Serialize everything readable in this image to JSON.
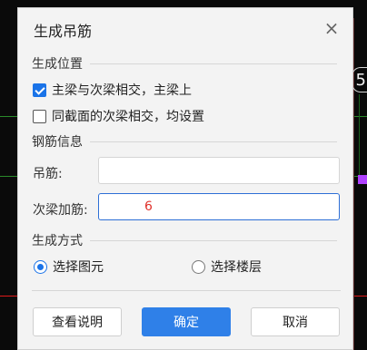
{
  "cad": {
    "axis_label": "5",
    "accent_line_color": "#e01a1a",
    "green_line_color": "#2a8a2a",
    "marker_color": "#b040ff"
  },
  "dialog": {
    "title": "生成吊筋",
    "close_icon": "close-icon",
    "position_section": "生成位置",
    "option1_label": "主梁与次梁相交，主梁上",
    "option1_checked": true,
    "option2_label": "同截面的次梁相交，均设置",
    "option2_checked": false,
    "rebar_section": "钢筋信息",
    "hanger_label": "吊筋:",
    "hanger_value": "",
    "extra_label": "次梁加筋:",
    "extra_value": "6",
    "method_section": "生成方式",
    "radio1_label": "选择图元",
    "radio1_selected": true,
    "radio2_label": "选择楼层",
    "radio2_selected": false,
    "help_button": "查看说明",
    "ok_button": "确定",
    "cancel_button": "取消",
    "accent_color": "#2f80e8"
  }
}
